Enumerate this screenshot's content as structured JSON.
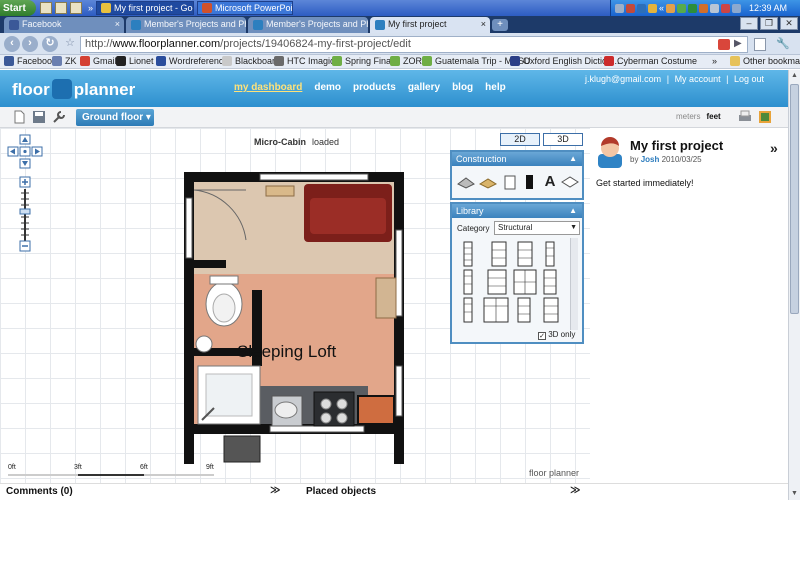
{
  "taskbar": {
    "start_label": "Start",
    "tasks": [
      {
        "label": "My first project - Goo...",
        "active": true
      },
      {
        "label": "Microsoft PowerPoint no...",
        "active": false
      }
    ],
    "clock": "12:39 AM"
  },
  "browser": {
    "tabs": [
      {
        "label": "Facebook"
      },
      {
        "label": "Member's Projects and Pho..."
      },
      {
        "label": "Member's Projects and Pho..."
      },
      {
        "label": "My first project"
      }
    ],
    "url_prefix": "http://",
    "url_host": "www.floorplanner.com",
    "url_path": "/projects/19406824-my-first-project/edit",
    "bookmarks": [
      "Facebook",
      "ZK",
      "Gmail",
      "Lionet",
      "Wordreference",
      "Blackboard",
      "HTC Imagio",
      "Spring Finals",
      "ZOR",
      "Guatemala Trip - MSSU",
      "Oxford English Diction...",
      "Cyberman Costume"
    ],
    "other_bookmarks": "Other bookmarks"
  },
  "site": {
    "logo_left": "floor",
    "logo_right": "planner",
    "nav": [
      "my dashboard",
      "demo",
      "products",
      "gallery",
      "blog",
      "help"
    ],
    "account_email": "j.klugh@gmail.com",
    "my_account": "My account",
    "logout": "Log out"
  },
  "editor": {
    "floor_button": "Ground floor ▾",
    "unit_meters": "meters",
    "unit_feet": "feet",
    "project_name": "Micro-Cabin",
    "project_status": "loaded",
    "view_2d": "2D",
    "view_3d": "3D",
    "room_label": "Sleeping Loft",
    "scale_labels": [
      "0ft",
      "3ft",
      "6ft",
      "9ft"
    ],
    "watermark": "floor planner"
  },
  "construction_panel": {
    "title": "Construction",
    "tools": [
      "wall-tool",
      "floor-tool",
      "door-tool",
      "window-tool",
      "text-tool",
      "dimension-tool"
    ],
    "text_tool_glyph": "A"
  },
  "library_panel": {
    "title": "Library",
    "category_label": "Category",
    "category_value": "Structural",
    "only3d_label": "3D only"
  },
  "sidebar": {
    "project_title": "My first project",
    "by": "by",
    "author": "Josh",
    "date": "2010/03/25",
    "get_started": "Get started immediately!"
  },
  "bottom": {
    "comments": "Comments (0)",
    "placed": "Placed objects"
  }
}
